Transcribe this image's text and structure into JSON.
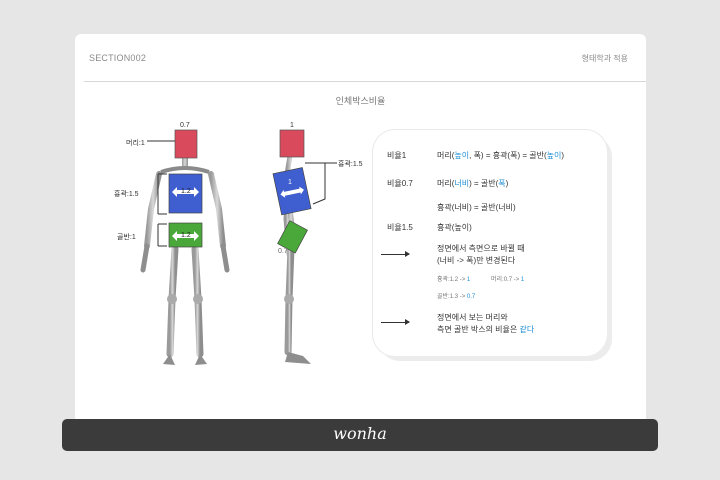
{
  "header": {
    "section": "SECTION002",
    "right_label": "형태학과 적용",
    "title": "인체박스비율"
  },
  "front": {
    "top_value": "0.7",
    "head_label": "머리:1",
    "chest_label": "흉곽:1.5",
    "chest_box": "1.2",
    "pelvis_label": "골반:1",
    "pelvis_box": "1.2"
  },
  "side": {
    "top_value": "1",
    "chest_label": "흉곽:1.5",
    "chest_box": "1",
    "pelvis_box": "0.7"
  },
  "info": {
    "rows": [
      {
        "key": "비율1",
        "pre": "머리(",
        "a1": "높이",
        "mid1": ", 폭) = 흉곽(폭) = 골반(",
        "a2": "높이",
        "post": ")"
      },
      {
        "key": "비율0.7",
        "pre": "머리(",
        "a1": "너비",
        "mid1": ") = 골반(",
        "a2": "폭",
        "post": ")"
      },
      {
        "key": "",
        "pre": "흉곽(너비) = 골반(너비)",
        "a1": "",
        "mid1": "",
        "a2": "",
        "post": ""
      },
      {
        "key": "비율1.5",
        "pre": "흉곽(높이)",
        "a1": "",
        "mid1": "",
        "a2": "",
        "post": ""
      }
    ],
    "note1_line1": "정면에서 측면으로 바뀔 때",
    "note1_line2": "(너비 -> 폭)만 변경된다",
    "small1_pre": "흉곽:1.2 -> ",
    "small1_val": "1",
    "small2_pre": "머리:0.7 -> ",
    "small2_val": "1",
    "small3_pre": "골반:1.3 -> ",
    "small3_val": "0.7",
    "note2_line1": "정면에서 보는 머리와",
    "note2_line2_pre": "측면 골반 박스의 비율은 ",
    "note2_line2_accent": "같다"
  },
  "footer": {
    "signature": "wonha"
  },
  "colors": {
    "head": "#d94a5c",
    "chest": "#3f5fd0",
    "pelvis": "#4aa83a",
    "accent": "#1e8fd6",
    "footer": "#3b3b3b"
  }
}
